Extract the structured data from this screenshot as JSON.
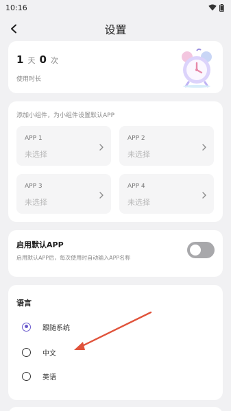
{
  "status_bar": {
    "time": "10:16"
  },
  "header": {
    "title": "设置"
  },
  "usage": {
    "days_value": "1",
    "days_unit": "天",
    "times_value": "0",
    "times_unit": "次",
    "caption": "使用时长"
  },
  "widgets": {
    "hint": "添加小组件，为小组件设置默认APP",
    "apps": [
      {
        "name": "APP 1",
        "state": "未选择"
      },
      {
        "name": "APP 2",
        "state": "未选择"
      },
      {
        "name": "APP 3",
        "state": "未选择"
      },
      {
        "name": "APP 4",
        "state": "未选择"
      }
    ]
  },
  "default_app": {
    "title": "启用默认APP",
    "description": "启用默认APP后，每次使用时自动输入APP名称",
    "enabled": false
  },
  "language": {
    "title": "语言",
    "options": [
      {
        "label": "跟随系统",
        "selected": true
      },
      {
        "label": "中文",
        "selected": false
      },
      {
        "label": "英语",
        "selected": false
      }
    ]
  },
  "colors": {
    "accent": "#6a5acd",
    "annotation_arrow": "#e0533b",
    "toggle_off": "#a8a8ab",
    "background": "#f1f1f3"
  }
}
